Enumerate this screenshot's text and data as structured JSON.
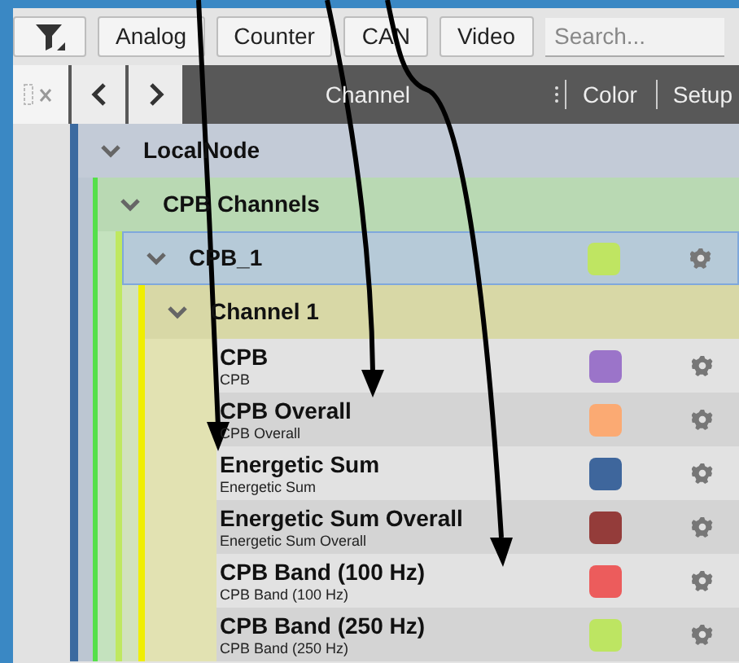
{
  "toolbar": {
    "filter_button": {
      "kind": "filter"
    },
    "buttons": [
      "Analog",
      "Counter",
      "CAN",
      "Video"
    ],
    "search": {
      "placeholder": "Search..."
    }
  },
  "header": {
    "columns": [
      "Channel",
      "Color",
      "Setup"
    ]
  },
  "tree": [
    {
      "label": "LocalNode",
      "expanded": true,
      "children": [
        {
          "label": "CPB Channels",
          "expanded": true,
          "children": [
            {
              "label": "CPB_1",
              "expanded": true,
              "selected": true,
              "color": "#bfe562",
              "children": [
                {
                  "label": "Channel 1",
                  "expanded": true,
                  "children": [
                    {
                      "label": "CPB",
                      "sublabel": "CPB",
                      "color": "#9b74c9",
                      "selected": false
                    },
                    {
                      "label": "CPB Overall",
                      "sublabel": "CPB Overall",
                      "color": "#fbaa73",
                      "selected": false
                    },
                    {
                      "label": "Energetic Sum",
                      "sublabel": "Energetic Sum",
                      "color": "#3e669c",
                      "selected": false
                    },
                    {
                      "label": "Energetic Sum Overall",
                      "sublabel": "Energetic Sum Overall",
                      "color": "#943c3a",
                      "selected": false
                    },
                    {
                      "label": "CPB Band (100 Hz)",
                      "sublabel": "CPB Band (100 Hz)",
                      "color": "#ec5c5c",
                      "selected": false
                    },
                    {
                      "label": "CPB Band (250 Hz)",
                      "sublabel": "CPB Band (250 Hz)",
                      "color": "#bde562",
                      "selected": false
                    }
                  ]
                }
              ]
            }
          ]
        }
      ]
    }
  ]
}
